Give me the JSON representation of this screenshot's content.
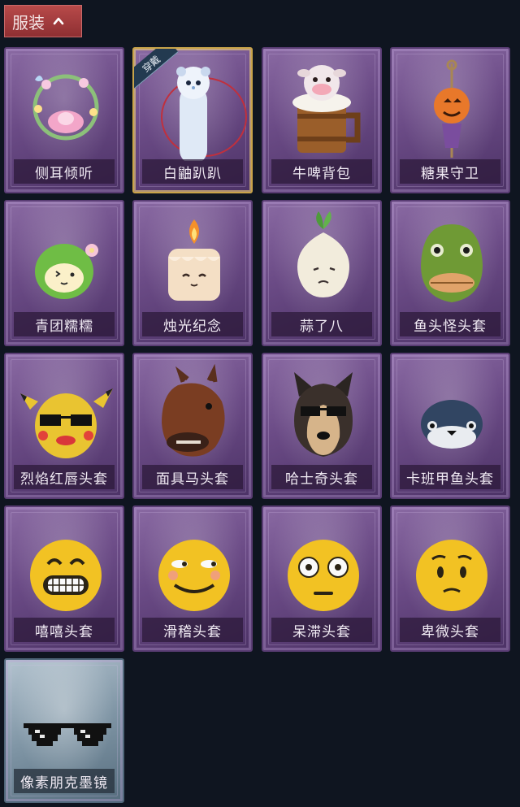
{
  "header": {
    "title": "服装",
    "toggle_icon": "chevron-up-icon"
  },
  "equipped_badge": "穿戴",
  "items": [
    {
      "label": "侧耳倾听",
      "icon": "flower-wreath-icon",
      "selected": false
    },
    {
      "label": "白鼬趴趴",
      "icon": "ermine-plush-icon",
      "selected": true
    },
    {
      "label": "牛啤背包",
      "icon": "cow-mug-icon",
      "selected": false
    },
    {
      "label": "糖果守卫",
      "icon": "pumpkin-scarecrow-icon",
      "selected": false
    },
    {
      "label": "青团糯糯",
      "icon": "green-dumpling-icon",
      "selected": false
    },
    {
      "label": "烛光纪念",
      "icon": "candle-icon",
      "selected": false
    },
    {
      "label": "蒜了八",
      "icon": "garlic-icon",
      "selected": false
    },
    {
      "label": "鱼头怪头套",
      "icon": "fish-head-mask-icon",
      "selected": false
    },
    {
      "label": "烈焰红唇头套",
      "icon": "pikachu-mask-icon",
      "selected": false
    },
    {
      "label": "面具马头套",
      "icon": "horse-mask-icon",
      "selected": false
    },
    {
      "label": "哈士奇头套",
      "icon": "husky-mask-icon",
      "selected": false
    },
    {
      "label": "卡班甲鱼头套",
      "icon": "turtle-head-mask-icon",
      "selected": false
    },
    {
      "label": "嘻嘻头套",
      "icon": "grin-emoji-mask-icon",
      "selected": false
    },
    {
      "label": "滑稽头套",
      "icon": "smirk-emoji-mask-icon",
      "selected": false
    },
    {
      "label": "呆滞头套",
      "icon": "flushed-emoji-mask-icon",
      "selected": false
    },
    {
      "label": "卑微头套",
      "icon": "pleading-emoji-mask-icon",
      "selected": false
    },
    {
      "label": "像素朋克墨镜",
      "icon": "pixel-sunglasses-icon",
      "selected": false
    }
  ],
  "colors": {
    "background": "#0f1520",
    "header_bg": "#a83c3e",
    "card_purple": "#6b4b86",
    "card_blue": "#7f95a5",
    "selected_border": "#c9a44a"
  }
}
